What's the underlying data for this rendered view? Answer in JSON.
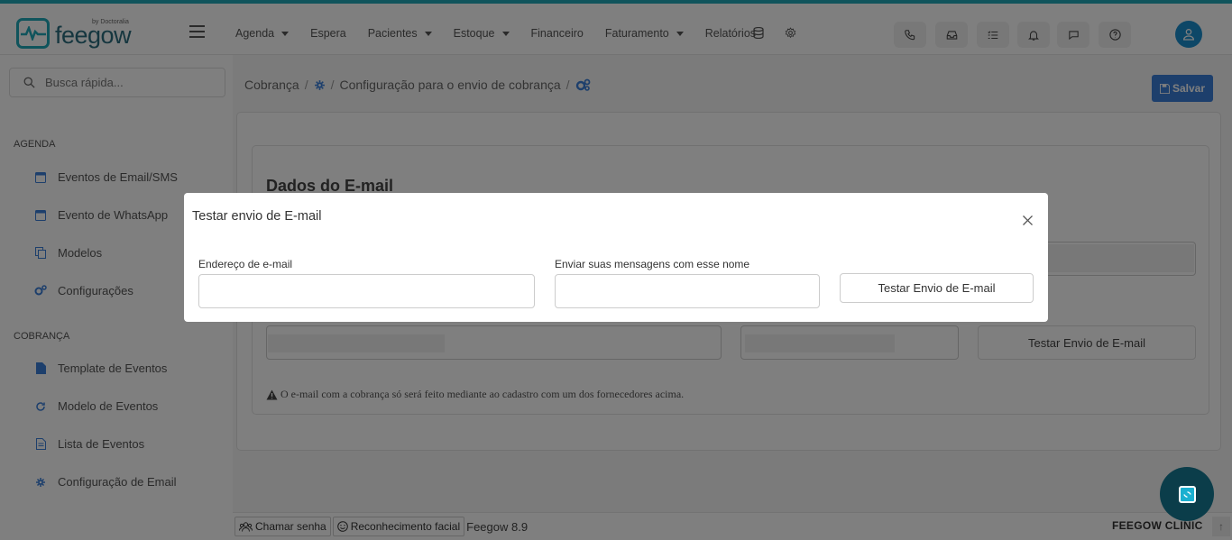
{
  "brand": {
    "logo_text": "feegow",
    "logo_by": "by Doctoralia"
  },
  "nav": {
    "items": [
      {
        "label": "Agenda",
        "dropdown": true
      },
      {
        "label": "Espera",
        "dropdown": false
      },
      {
        "label": "Pacientes",
        "dropdown": true
      },
      {
        "label": "Estoque",
        "dropdown": true
      },
      {
        "label": "Financeiro",
        "dropdown": false
      },
      {
        "label": "Faturamento",
        "dropdown": true
      },
      {
        "label": "Relatórios",
        "dropdown": false
      }
    ],
    "extra_icons": [
      "database-icon",
      "gear-icon"
    ],
    "toolbar_icons": [
      "phone-icon",
      "inbox-icon",
      "checklist-icon",
      "bell-icon",
      "chat-icon",
      "help-icon",
      "user-icon"
    ]
  },
  "sidebar": {
    "search_placeholder": "Busca rápida...",
    "sections": [
      {
        "title": "AGENDA",
        "items": [
          {
            "label": "Eventos de Email/SMS",
            "icon": "calendar-icon"
          },
          {
            "label": "Evento de WhatsApp",
            "icon": "calendar-icon"
          },
          {
            "label": "Modelos",
            "icon": "copy-icon"
          },
          {
            "label": "Configurações",
            "icon": "cogs-icon"
          }
        ]
      },
      {
        "title": "COBRANÇA",
        "items": [
          {
            "label": "Template de Eventos",
            "icon": "file-icon"
          },
          {
            "label": "Modelo de Eventos",
            "icon": "refresh-icon"
          },
          {
            "label": "Lista de Eventos",
            "icon": "file-text-icon"
          },
          {
            "label": "Configuração de Email",
            "icon": "gear-icon"
          }
        ]
      }
    ]
  },
  "breadcrumb": {
    "root": "Cobrança",
    "current": "Configuração para o envio de cobrança"
  },
  "header": {
    "save_label": "Salvar"
  },
  "card": {
    "title": "Dados do E-mail",
    "test_button": "Testar Envio de E-mail",
    "warning": "O e-mail com a cobrança só será feito mediante ao cadastro com um dos fornecedores acima."
  },
  "footer": {
    "call_label": "Chamar senha",
    "face_label": "Reconhecimento facial",
    "version": "Feegow 8.9",
    "brand": "FEEGOW CLINIC"
  },
  "modal": {
    "title": "Testar envio de E-mail",
    "email_label": "Endereço de e-mail",
    "email_value": "",
    "name_label": "Enviar suas mensagens com esse nome",
    "name_value": "",
    "submit_label": "Testar Envio de E-mail"
  },
  "colors": {
    "accent": "#20a8b8",
    "primary_button": "#3a7ed8",
    "avatar": "#1a8fcf",
    "chat_fab": "#0b3d4a"
  }
}
